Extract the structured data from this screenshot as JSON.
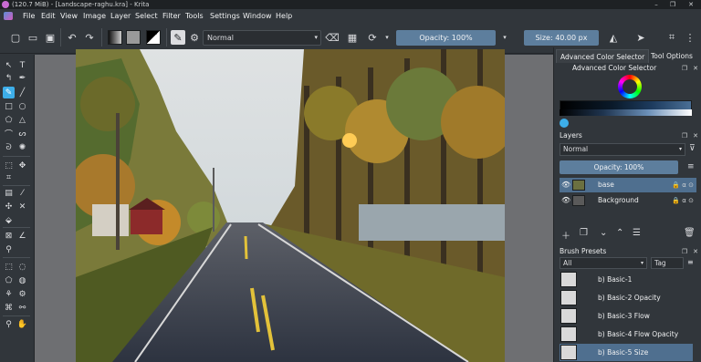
{
  "window": {
    "title": "(120.7 MiB) - [Landscape-raghu.kra] - Krita",
    "controls": [
      "–",
      "❐",
      "✕"
    ]
  },
  "menu": {
    "items": [
      "File",
      "Edit",
      "View",
      "Image",
      "Layer",
      "Select",
      "Filter",
      "Tools",
      "Settings",
      "Window",
      "Help"
    ]
  },
  "toolbar": {
    "blend_mode": "Normal",
    "opacity": "Opacity: 100%",
    "size": "Size: 40.00 px"
  },
  "dock": {
    "tabs": [
      "Advanced Color Selector",
      "Tool Options"
    ],
    "color_panel_title": "Advanced Color Selector",
    "layers_title": "Layers",
    "layer_blend_mode": "Normal",
    "layer_opacity": "Opacity:  100%",
    "layers": [
      {
        "name": "base",
        "active": true
      },
      {
        "name": "Background",
        "active": false
      }
    ],
    "presets_title": "Brush Presets",
    "preset_filter": "All",
    "preset_tag": "Tag",
    "presets": [
      {
        "name": "b) Basic-1",
        "active": false
      },
      {
        "name": "b) Basic-2 Opacity",
        "active": false
      },
      {
        "name": "b) Basic-3 Flow",
        "active": false
      },
      {
        "name": "b) Basic-4 Flow Opacity",
        "active": false
      },
      {
        "name": "b) Basic-5 Size",
        "active": true
      }
    ]
  },
  "colors": {
    "accent": "#3daee9",
    "selection": "#4f6f8f",
    "slider": "#5d7e9d",
    "panel_bg": "#31363b"
  }
}
